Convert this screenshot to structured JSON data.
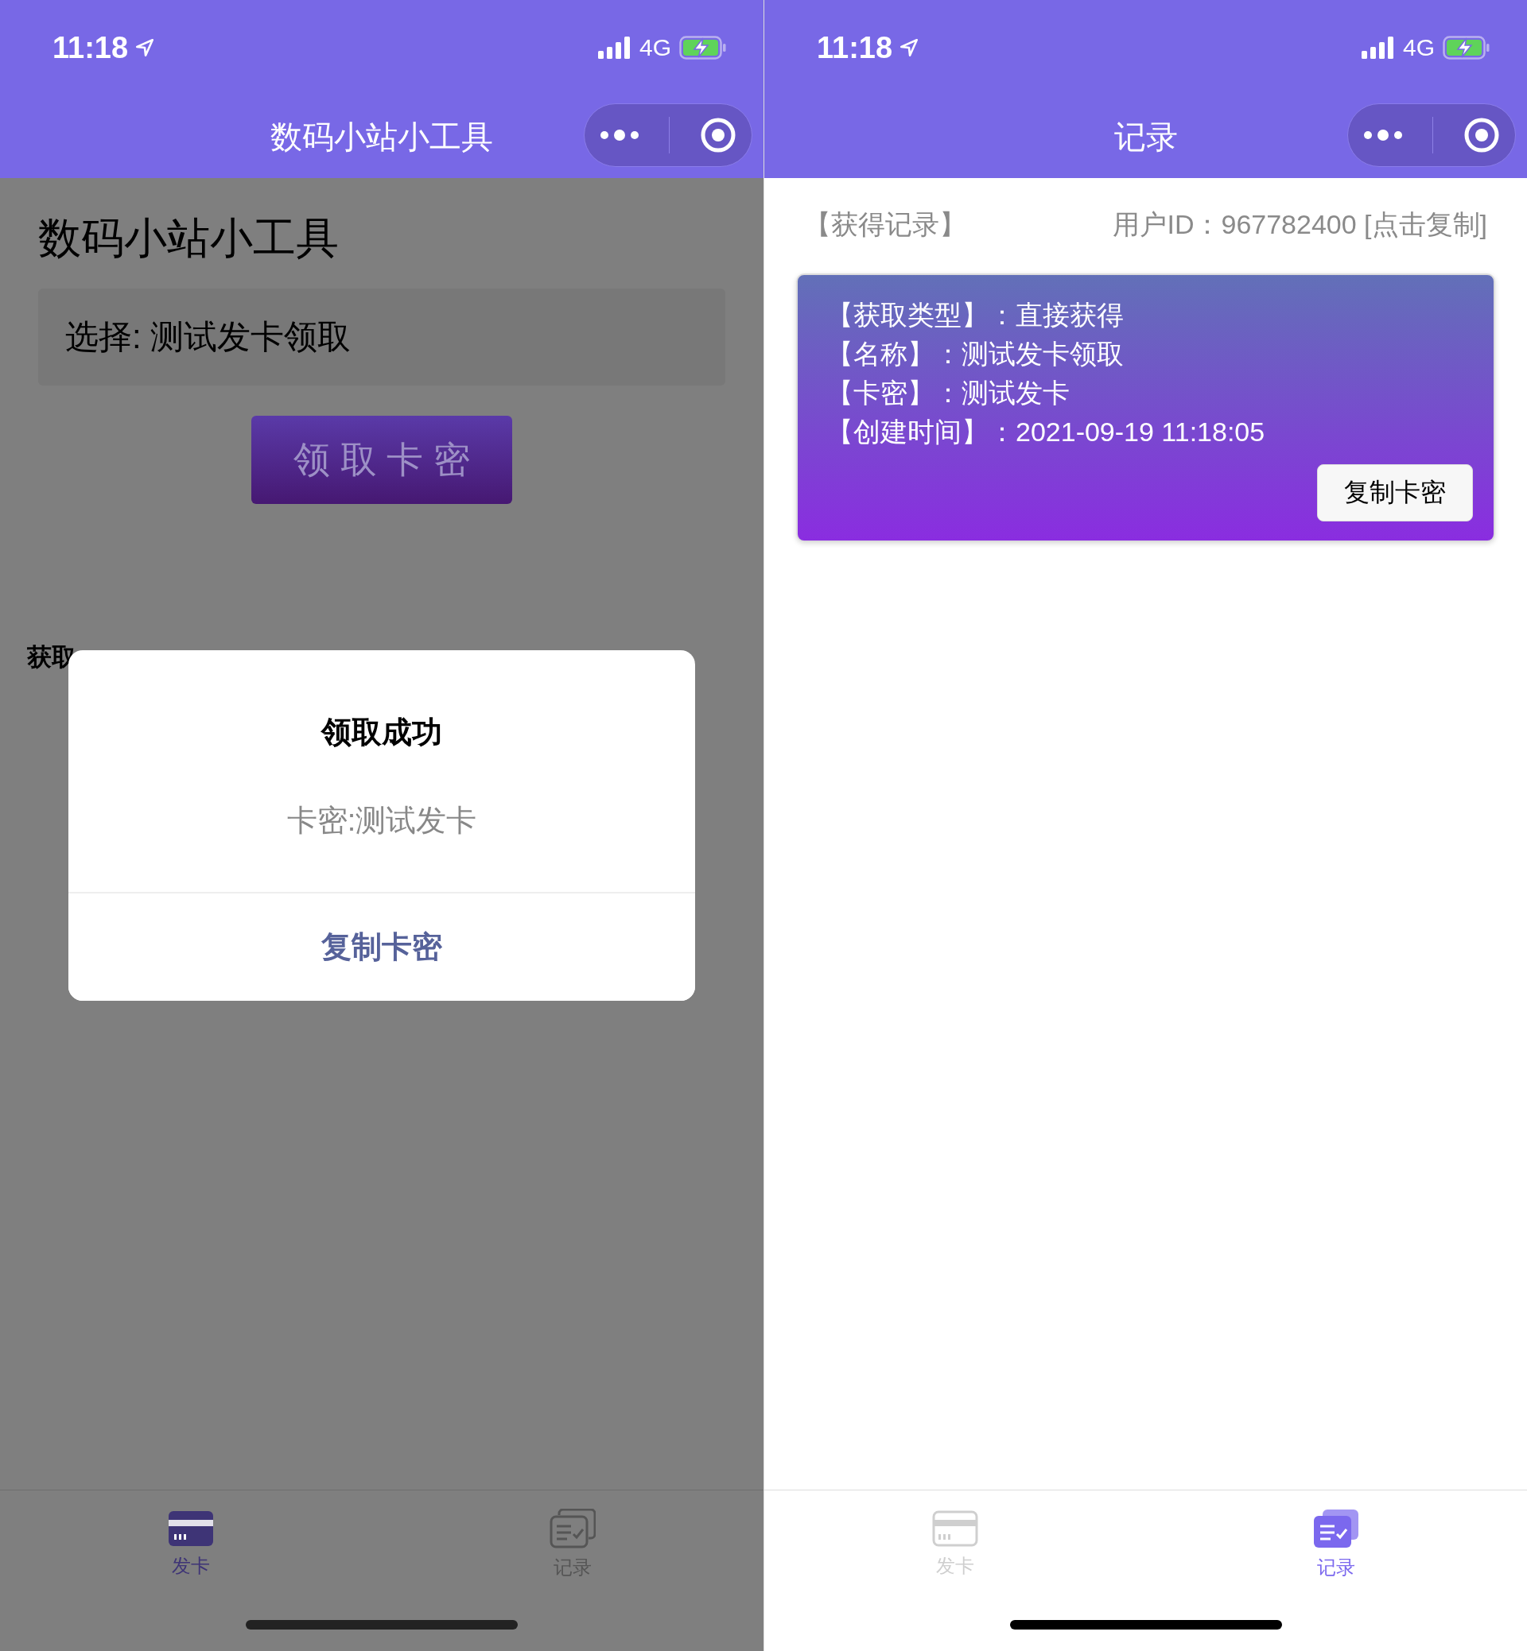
{
  "issue_screen": {
    "status_bar": {
      "time": "11:18",
      "network": "4G"
    },
    "nav_bar": {
      "title": "数码小站小工具"
    },
    "heading": "数码小站小工具",
    "selection": "选择: 测试发卡领取",
    "claim_button": "领 取 卡 密",
    "section_label": "获取",
    "modal": {
      "title": "领取成功",
      "message": "卡密:测试发卡",
      "button": "复制卡密"
    },
    "tab_bar": [
      {
        "label": "发卡",
        "kind": "card",
        "selected": true
      },
      {
        "label": "记录",
        "kind": "records",
        "selected": false
      }
    ]
  },
  "records_screen": {
    "status_bar": {
      "time": "11:18",
      "network": "4G"
    },
    "nav_bar": {
      "title": "记录"
    },
    "section_title": "【获得记录】",
    "user_id": "用户ID：967782400 [点击复制]",
    "records": [
      {
        "fields": [
          {
            "label": "【获取类型】：",
            "value": "直接获得"
          },
          {
            "label": "【名称】：",
            "value": "测试发卡领取"
          },
          {
            "label": "【卡密】：",
            "value": "测试发卡"
          },
          {
            "label": "【创建时间】：",
            "value": "2021-09-19 11:18:05"
          }
        ],
        "button": "复制卡密"
      }
    ],
    "tab_bar": [
      {
        "label": "发卡",
        "kind": "card",
        "selected": false
      },
      {
        "label": "记录",
        "kind": "records",
        "selected": true
      }
    ]
  }
}
